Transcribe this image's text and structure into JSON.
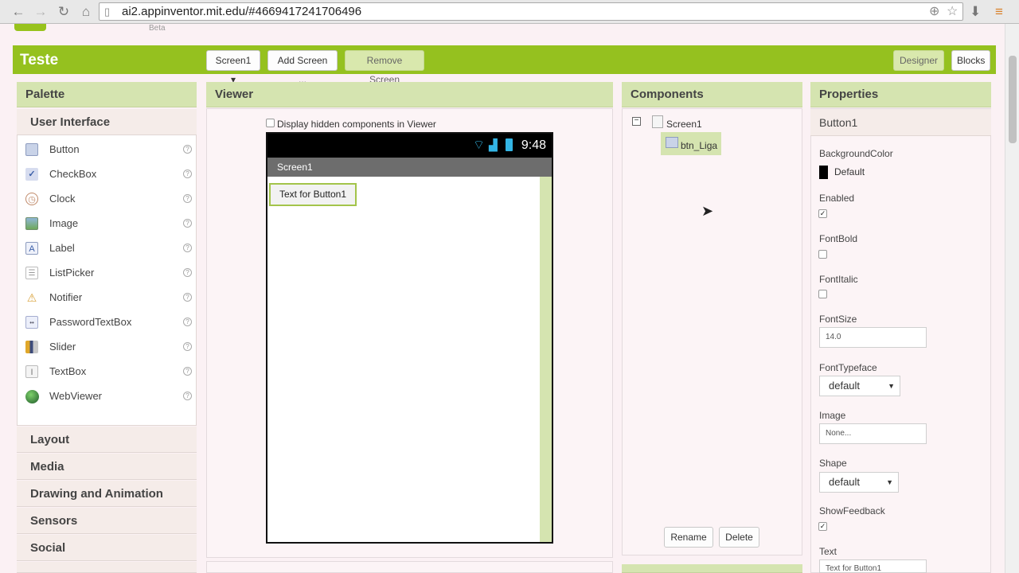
{
  "browser": {
    "url": "ai2.appinventor.mit.edu/#4669417241706496"
  },
  "app": {
    "beta_label": "Beta",
    "project_title": "Teste",
    "toolbar": {
      "screen_dropdown": "Screen1 ▾",
      "add_screen": "Add Screen ...",
      "remove_screen": "Remove Screen",
      "designer": "Designer",
      "blocks": "Blocks"
    }
  },
  "palette": {
    "title": "Palette",
    "section": "User Interface",
    "items": [
      {
        "label": "Button",
        "icon": "button-icon"
      },
      {
        "label": "CheckBox",
        "icon": "checkbox-icon"
      },
      {
        "label": "Clock",
        "icon": "clock-icon"
      },
      {
        "label": "Image",
        "icon": "image-icon"
      },
      {
        "label": "Label",
        "icon": "label-icon"
      },
      {
        "label": "ListPicker",
        "icon": "listpicker-icon"
      },
      {
        "label": "Notifier",
        "icon": "notifier-icon"
      },
      {
        "label": "PasswordTextBox",
        "icon": "password-icon"
      },
      {
        "label": "Slider",
        "icon": "slider-icon"
      },
      {
        "label": "TextBox",
        "icon": "textbox-icon"
      },
      {
        "label": "WebViewer",
        "icon": "webviewer-icon"
      }
    ],
    "categories": [
      "Layout",
      "Media",
      "Drawing and Animation",
      "Sensors",
      "Social"
    ]
  },
  "viewer": {
    "title": "Viewer",
    "hidden_checkbox_label": "Display hidden components in Viewer",
    "phone_time": "9:48",
    "screen_title": "Screen1",
    "button_text": "Text for Button1"
  },
  "components": {
    "title": "Components",
    "tree": {
      "root": "Screen1",
      "child": "btn_Liga"
    },
    "rename": "Rename",
    "delete": "Delete"
  },
  "properties": {
    "title": "Properties",
    "component": "Button1",
    "background_color": {
      "label": "BackgroundColor",
      "value": "Default",
      "swatch": "#000000"
    },
    "enabled": {
      "label": "Enabled",
      "checked": true
    },
    "font_bold": {
      "label": "FontBold",
      "checked": false
    },
    "font_italic": {
      "label": "FontItalic",
      "checked": false
    },
    "font_size": {
      "label": "FontSize",
      "value": "14.0"
    },
    "font_typeface": {
      "label": "FontTypeface",
      "value": "default"
    },
    "image": {
      "label": "Image",
      "value": "None..."
    },
    "shape": {
      "label": "Shape",
      "value": "default"
    },
    "show_feedback": {
      "label": "ShowFeedback",
      "checked": true
    },
    "text": {
      "label": "Text",
      "value": "Text for Button1"
    }
  },
  "colors": {
    "accent_green": "#95c11f",
    "panel_header": "#d5e4b0"
  }
}
